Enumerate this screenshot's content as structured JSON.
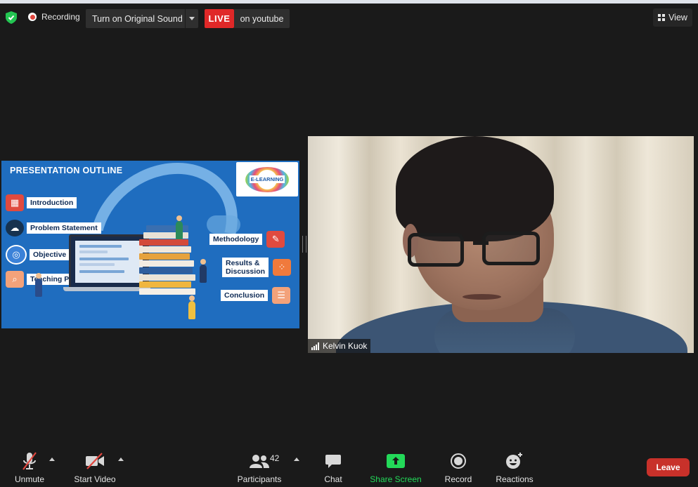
{
  "topbar": {
    "recording_label": "Recording",
    "original_sound_label": "Turn on Original Sound",
    "live_label": "LIVE",
    "live_platform": "on youtube",
    "view_label": "View"
  },
  "shared_screen": {
    "title": "PRESENTATION OUTLINE",
    "logo_text": "E-LEARNING",
    "items_left": [
      "Introduction",
      "Problem Statement",
      "Objective",
      "Teaching Pedagogy"
    ],
    "items_right": [
      "Methodology",
      "Results & Discussion",
      "Conclusion"
    ]
  },
  "video": {
    "participant_name": "Kelvin Kuok"
  },
  "toolbar": {
    "unmute": "Unmute",
    "start_video": "Start Video",
    "participants": "Participants",
    "participants_count": "42",
    "chat": "Chat",
    "share_screen": "Share Screen",
    "record": "Record",
    "reactions": "Reactions",
    "leave": "Leave"
  },
  "colors": {
    "live_red": "#e02828",
    "share_green": "#23d959",
    "leave_red": "#c8312a",
    "slide_blue": "#1f6dbf"
  }
}
